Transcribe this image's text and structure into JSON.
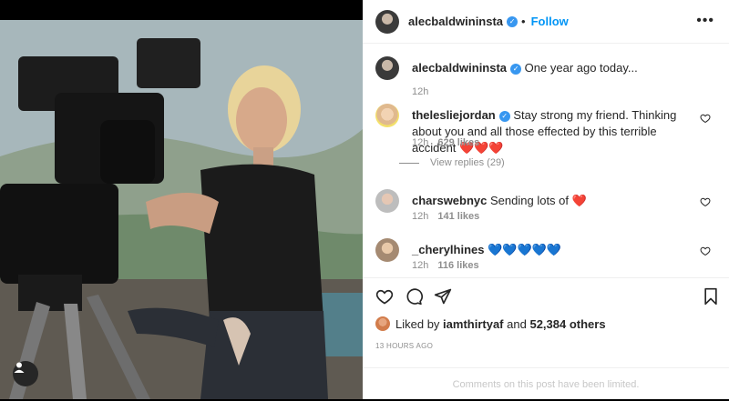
{
  "post": {
    "author": "alecbaldwininsta",
    "separator": "•",
    "follow_label": "Follow",
    "more_label": "•••"
  },
  "caption": {
    "user": "alecbaldwininsta",
    "text": "One year ago today...",
    "time": "12h"
  },
  "comments": [
    {
      "user": "theleslie​jordan",
      "text": "Stay strong my friend. Thinking about you and all those effected by this terrible accident ",
      "emoji": "❤️❤️❤️",
      "time": "12h",
      "likes": "629 likes"
    },
    {
      "user": "charswebnyc",
      "text": "Sending lots of ",
      "emoji": "❤️",
      "time": "12h",
      "likes": "141 likes"
    },
    {
      "user": "_cherylhines",
      "text": "",
      "emoji": "💙💙💙💙💙",
      "time": "12h",
      "likes": "116 likes"
    }
  ],
  "view_replies": "View replies (29)",
  "liked_by": {
    "prefix": "Liked by ",
    "user": "iamthirtyaf",
    "middle": " and ",
    "count": "52,384 others"
  },
  "time_ago": "13 HOURS AGO",
  "limited_notice": "Comments on this post have been limited.",
  "colors": {
    "accent": "#0095f6",
    "verified": "#3897f0",
    "heart": "#ed4956",
    "blue_heart": "#3897f0"
  }
}
